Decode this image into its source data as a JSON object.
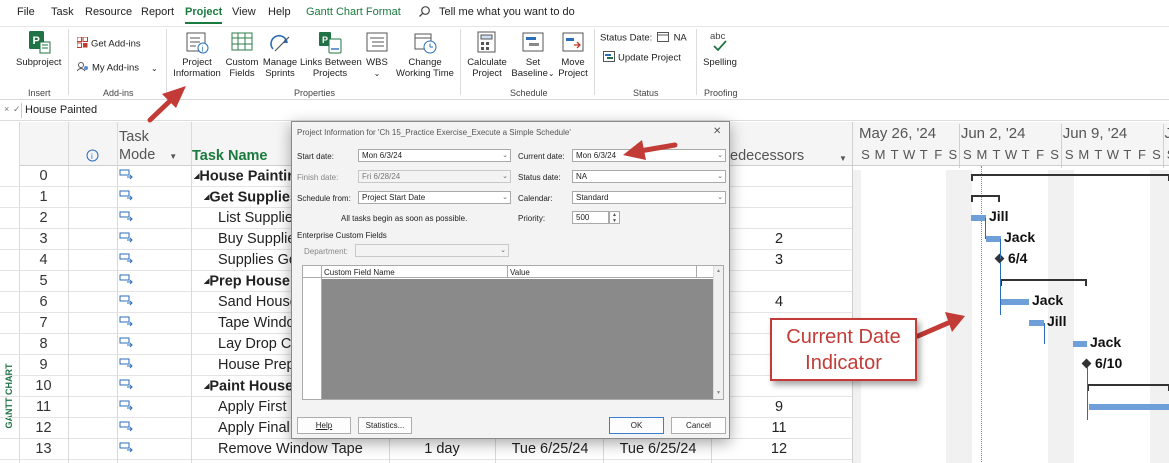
{
  "menu": {
    "items": [
      "File",
      "Task",
      "Resource",
      "Report",
      "Project",
      "View",
      "Help",
      "Gantt Chart Format"
    ],
    "active": "Project",
    "tell_me": "Tell me what you want to do"
  },
  "ribbon": {
    "subproject": "Subproject",
    "get_addins": "Get Add-ins",
    "my_addins": "My Add-ins",
    "project_information": [
      "Project",
      "Information"
    ],
    "custom_fields": [
      "Custom",
      "Fields"
    ],
    "manage_sprints": [
      "Manage",
      "Sprints"
    ],
    "links_between_projects": [
      "Links Between",
      "Projects"
    ],
    "wbs": "WBS",
    "change_working_time": [
      "Change",
      "Working Time"
    ],
    "calculate_project": [
      "Calculate",
      "Project"
    ],
    "set_baseline": [
      "Set",
      "Baseline"
    ],
    "move_project": [
      "Move",
      "Project"
    ],
    "status_date_label": "Status Date:",
    "status_date_value": "NA",
    "update_project": "Update Project",
    "spelling": "Spelling",
    "abc": "abc",
    "groups": {
      "insert": "Insert",
      "addins": "Add-ins",
      "properties": "Properties",
      "schedule": "Schedule",
      "status": "Status",
      "proofing": "Proofing"
    }
  },
  "formula_bar": {
    "value": "House Painted"
  },
  "table": {
    "headers": {
      "task_mode": [
        "Task",
        "Mode"
      ],
      "task_name": "Task Name",
      "predecessors": "edecessors",
      "info_icon": "i"
    },
    "side_label": "GANTT CHART",
    "rows": [
      {
        "id": "0",
        "name": "House Paintin",
        "level": 0,
        "summary": true,
        "pred": "",
        "duration": "",
        "start": "",
        "finish": ""
      },
      {
        "id": "1",
        "name": "Get Supplies",
        "level": 1,
        "summary": true,
        "pred": "",
        "duration": "",
        "start": "",
        "finish": ""
      },
      {
        "id": "2",
        "name": "List Supplies",
        "level": 2,
        "summary": false,
        "pred": "",
        "duration": "",
        "start": "",
        "finish": ""
      },
      {
        "id": "3",
        "name": "Buy Supplies",
        "level": 2,
        "summary": false,
        "pred": "2",
        "duration": "",
        "start": "",
        "finish": ""
      },
      {
        "id": "4",
        "name": "Supplies Got",
        "level": 2,
        "summary": false,
        "pred": "3",
        "duration": "",
        "start": "",
        "finish": ""
      },
      {
        "id": "5",
        "name": "Prep House",
        "level": 1,
        "summary": true,
        "pred": "",
        "duration": "",
        "start": "",
        "finish": ""
      },
      {
        "id": "6",
        "name": "Sand House",
        "level": 2,
        "summary": false,
        "pred": "4",
        "duration": "",
        "start": "",
        "finish": ""
      },
      {
        "id": "7",
        "name": "Tape Windov",
        "level": 2,
        "summary": false,
        "pred": "",
        "duration": "",
        "start": "",
        "finish": ""
      },
      {
        "id": "8",
        "name": "Lay Drop Clo",
        "level": 2,
        "summary": false,
        "pred": "",
        "duration": "",
        "start": "",
        "finish": ""
      },
      {
        "id": "9",
        "name": "House Prepp",
        "level": 2,
        "summary": false,
        "pred": "",
        "duration": "",
        "start": "",
        "finish": ""
      },
      {
        "id": "10",
        "name": "Paint House",
        "level": 1,
        "summary": true,
        "pred": "",
        "duration": "",
        "start": "",
        "finish": ""
      },
      {
        "id": "11",
        "name": "Apply First C",
        "level": 2,
        "summary": false,
        "pred": "9",
        "duration": "",
        "start": "",
        "finish": ""
      },
      {
        "id": "12",
        "name": "Apply Final C",
        "level": 2,
        "summary": false,
        "pred": "11",
        "duration": "",
        "start": "",
        "finish": ""
      },
      {
        "id": "13",
        "name": "Remove Window Tape",
        "level": 2,
        "summary": false,
        "pred": "12",
        "duration": "1 day",
        "start": "Tue 6/25/24",
        "finish": "Tue 6/25/24"
      }
    ]
  },
  "gantt": {
    "weeks": [
      "May 26, '24",
      "Jun 2, '24",
      "Jun 9, '24",
      "J"
    ],
    "days": [
      "S",
      "M",
      "T",
      "W",
      "T",
      "F",
      "S",
      "S",
      "M",
      "T",
      "W",
      "T",
      "F",
      "S",
      "S",
      "M",
      "T",
      "W",
      "T",
      "F",
      "S",
      "S"
    ],
    "labels": {
      "r2": "Jill",
      "r3": "Jack",
      "r4": "6/4",
      "r6": "Jack",
      "r7": "Jill",
      "r8": "Jack",
      "r9": "6/10"
    }
  },
  "dialog": {
    "title": "Project Information for 'Ch 15_Practice Exercise_Execute a Simple Schedule'",
    "close": "✕",
    "start_date_label": "Start date:",
    "start_date": "Mon 6/3/24",
    "finish_date_label": "Finish date:",
    "finish_date": "Fri 6/28/24",
    "schedule_from_label": "Schedule from:",
    "schedule_from": "Project Start Date",
    "note": "All tasks begin as soon as possible.",
    "current_date_label": "Current date:",
    "current_date": "Mon 6/3/24",
    "status_date_label": "Status date:",
    "status_date": "NA",
    "calendar_label": "Calendar:",
    "calendar": "Standard",
    "priority_label": "Priority:",
    "priority": "500",
    "enterprise_label": "Enterprise Custom Fields",
    "department_label": "Department:",
    "col_custom_field": "Custom Field Name",
    "col_value": "Value",
    "help": "Help",
    "statistics": "Statistics...",
    "ok": "OK",
    "cancel": "Cancel"
  },
  "callout": {
    "line1": "Current Date",
    "line2": "Indicator"
  },
  "colors": {
    "accent": "#1b7a3e",
    "arrow": "#c23b36",
    "bar": "#6f9fd8"
  }
}
